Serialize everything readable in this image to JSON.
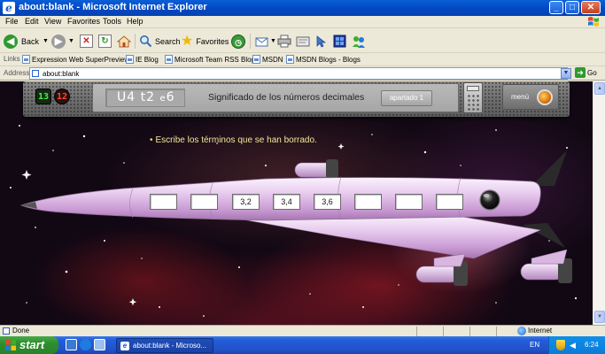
{
  "window": {
    "title": "about:blank - Microsoft Internet Explorer",
    "minimize": "_",
    "maximize": "□",
    "close": "✕"
  },
  "menu": [
    "File",
    "Edit",
    "View",
    "Favorites",
    "Tools",
    "Help"
  ],
  "toolbar": {
    "back_label": "Back",
    "search_label": "Search",
    "favorites_label": "Favorites"
  },
  "links": {
    "label": "Links",
    "items": [
      "Expression Web SuperPreview",
      "IE Blog",
      "Microsoft Team RSS Blog",
      "MSDN",
      "MSDN Blogs - Blogs"
    ]
  },
  "address": {
    "label": "Address",
    "value": "about:blank",
    "go_label": "Go"
  },
  "app": {
    "counter_green": "13",
    "counter_red": "12",
    "code_u": "U4",
    "code_t": "t2",
    "code_e_prefix": "e",
    "code_e": "6",
    "unit_title": "Significado de los números decimales",
    "apartado_label": "apartado 1",
    "menu_label": "menú",
    "instruction": "Escribe los términos que se han borrado.",
    "blanks": [
      "",
      "",
      "3,2",
      "3,4",
      "3,6",
      "",
      "",
      ""
    ]
  },
  "status": {
    "text": "Done",
    "zone": "Internet"
  },
  "taskbar": {
    "start_label": "start",
    "task_label": "about:blank - Microso...",
    "language": "EN",
    "clock": "6:24"
  },
  "colors": {
    "titlebar": "#0349c4",
    "chrome": "#ece9d8",
    "rocket_body": "#e6c8ec",
    "instruction_text": "#f3e79b"
  }
}
